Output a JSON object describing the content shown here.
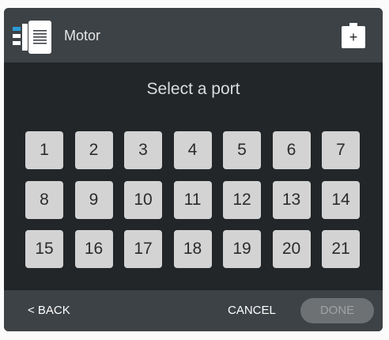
{
  "header": {
    "title": "Motor",
    "device_icon": "motor-icon",
    "action_icon": "battery-plus-icon",
    "action_symbol": "+"
  },
  "prompt": "Select a port",
  "ports": [
    "1",
    "2",
    "3",
    "4",
    "5",
    "6",
    "7",
    "8",
    "9",
    "10",
    "11",
    "12",
    "13",
    "14",
    "15",
    "16",
    "17",
    "18",
    "19",
    "20",
    "21"
  ],
  "footer": {
    "back_label": "< BACK",
    "cancel_label": "CANCEL",
    "done_label": "DONE"
  },
  "colors": {
    "background": "#222629",
    "header": "#3d4246",
    "port_button": "#d3d3d3",
    "done_disabled": "#6d7174",
    "accent_blue": "#2b9bd6"
  }
}
